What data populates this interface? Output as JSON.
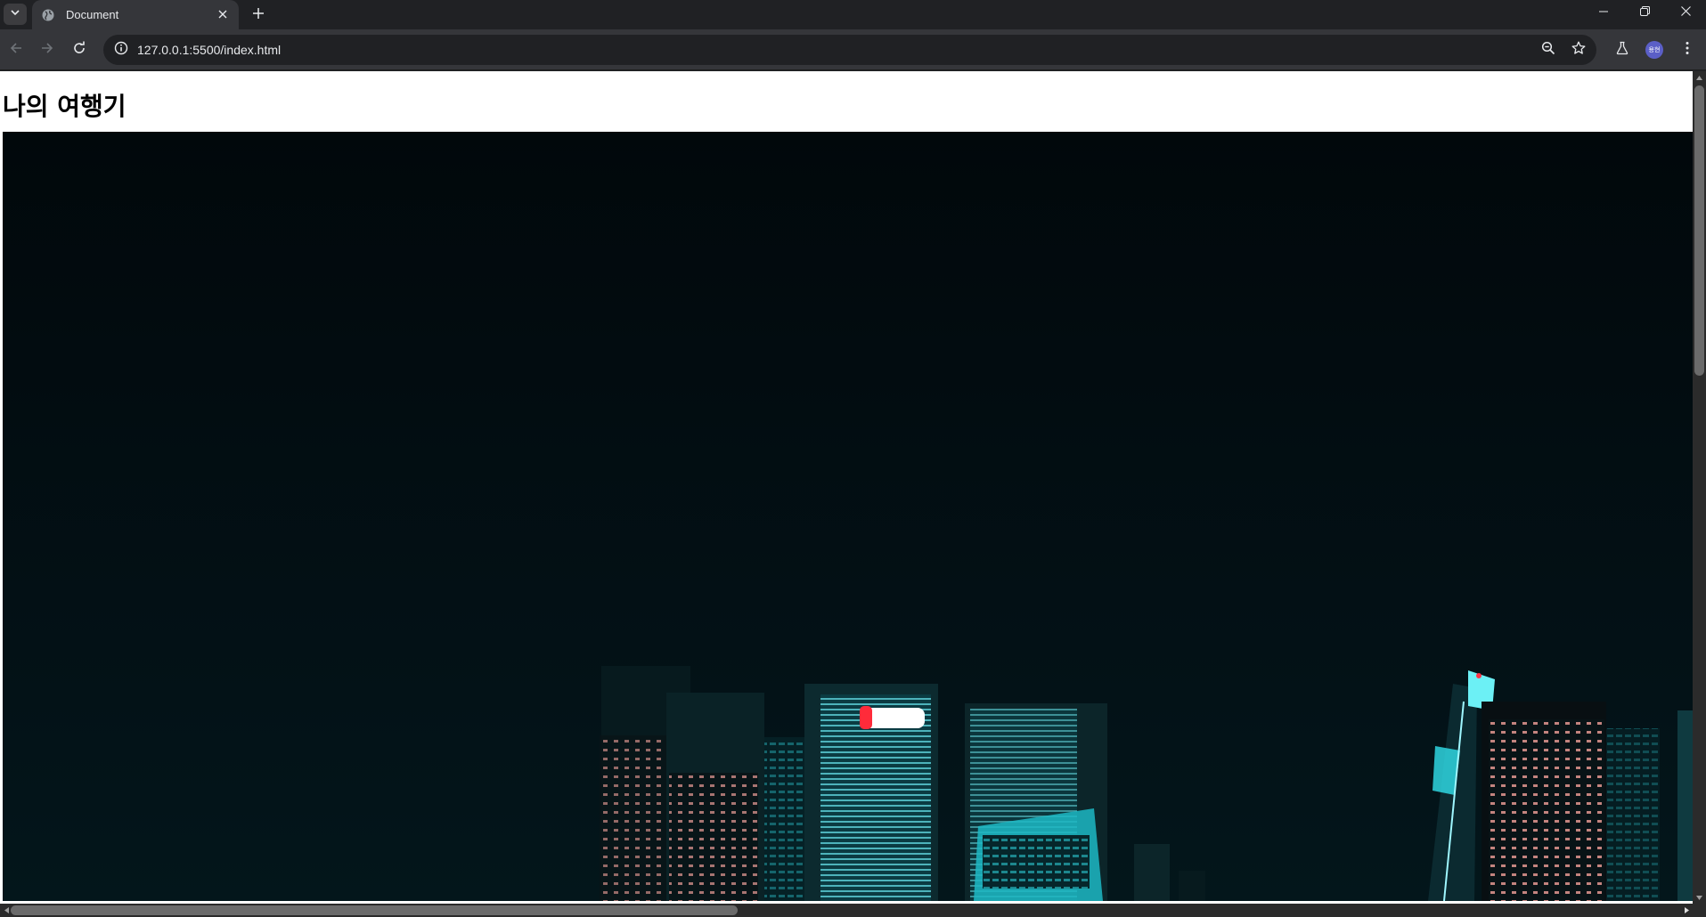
{
  "browser": {
    "tab": {
      "title": "Document",
      "favicon": "globe-icon"
    },
    "address_bar": {
      "url": "127.0.0.1:5500/index.html"
    },
    "profile_avatar_text": "용현",
    "icons": {
      "tab_search": "chevron-down-icon",
      "tab_close": "close-icon",
      "new_tab": "plus-icon",
      "minimize": "minimize-icon",
      "restore": "restore-icon",
      "close_window": "close-icon",
      "back": "arrow-left-icon",
      "forward": "arrow-right-icon",
      "reload": "reload-icon",
      "site_info": "info-icon",
      "zoom": "zoom-out-icon",
      "bookmark": "star-icon",
      "labs": "flask-icon",
      "menu": "kebab-menu-icon"
    }
  },
  "page": {
    "heading": "나의 여행기",
    "hero_image": {
      "description_icon": "night-city-skyline-image"
    }
  },
  "colors": {
    "browser_frame": "#202124",
    "toolbar": "#35363a",
    "page_background": "#ffffff",
    "hero_sky": "#020b0f",
    "building_glow": "#2fd6e0"
  }
}
